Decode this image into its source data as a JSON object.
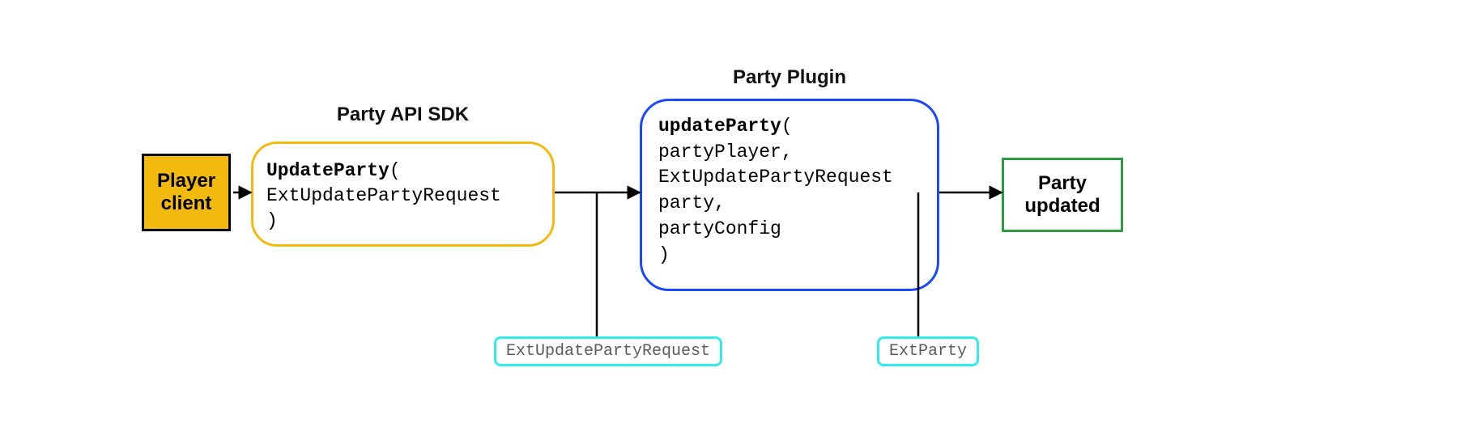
{
  "nodes": {
    "player_client": {
      "line1": "Player",
      "line2": "client"
    },
    "api_sdk": {
      "title": "Party API SDK",
      "func": "UpdateParty",
      "open": "(",
      "arg1": " ExtUpdatePartyRequest",
      "close": ")"
    },
    "plugin": {
      "title": "Party Plugin",
      "func": "updateParty",
      "open": "(",
      "arg1": " partyPlayer,",
      "arg2": " ExtUpdatePartyRequest",
      "arg3": " party,",
      "arg4": " partyConfig",
      "close": " )"
    },
    "party_updated": {
      "line1": "Party",
      "line2": "updated"
    }
  },
  "pills": {
    "ext_request": "ExtUpdatePartyRequest",
    "ext_party": "ExtParty"
  }
}
